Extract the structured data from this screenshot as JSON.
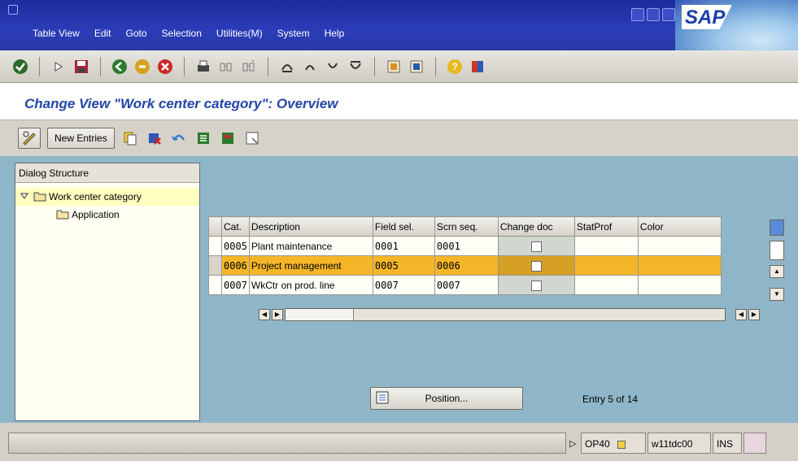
{
  "menu": [
    "Table View",
    "Edit",
    "Goto",
    "Selection",
    "Utilities(M)",
    "System",
    "Help"
  ],
  "logo_text": "SAP",
  "title": "Change View \"Work center category\": Overview",
  "app_toolbar": {
    "new_entries": "New Entries"
  },
  "dialog": {
    "header": "Dialog Structure",
    "items": [
      "Work center category",
      "Application"
    ]
  },
  "table": {
    "headers": [
      "Cat.",
      "Description",
      "Field sel.",
      "Scrn seq.",
      "Change doc",
      "StatProf",
      "Color"
    ],
    "rows": [
      {
        "cat": "0005",
        "desc": "Plant maintenance",
        "field": "0001",
        "scrn": "0001",
        "status": "",
        "color": ""
      },
      {
        "cat": "0006",
        "desc": "Project management",
        "field": "0005",
        "scrn": "0006",
        "status": "",
        "color": ""
      },
      {
        "cat": "0007",
        "desc": "WkCtr on prod. line",
        "field": "0007",
        "scrn": "0007",
        "status": "",
        "color": ""
      }
    ]
  },
  "position_button": "Position...",
  "entry_info": "Entry 5 of 14",
  "status": {
    "transaction": "OP40",
    "server": "w11tdc00",
    "mode": "INS"
  },
  "colors": {
    "title_blue": "#2245a8",
    "highlight": "#f4b628",
    "body_bg": "#8fb6c8"
  }
}
